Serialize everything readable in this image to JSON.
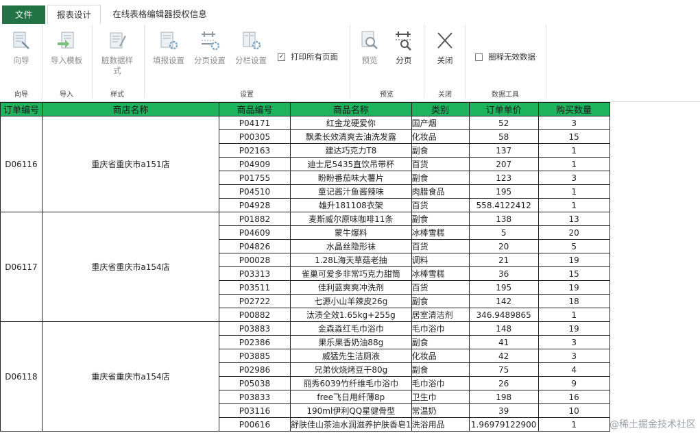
{
  "tabs": {
    "file": "文件",
    "report_design": "报表设计",
    "license_info": "在线表格编辑器授权信息"
  },
  "ribbon": {
    "wizard": "向导",
    "import_template": "导入模板",
    "dirty_style": "脏数据样式",
    "fill_settings": "填报设置",
    "page_settings": "分页设置",
    "column_settings": "分栏设置",
    "print_all": "打印所有页面",
    "preview": "预览",
    "paging": "分页",
    "close": "关闭",
    "circle_invalid": "圈释无效数据",
    "groups": {
      "wizard": "向导",
      "import": "导入",
      "style": "样式",
      "settings": "设置",
      "preview": "预览",
      "close": "关闭",
      "data_tools": "数据工具"
    }
  },
  "table": {
    "headers": [
      "订单编号",
      "商店名称",
      "商品编号",
      "商品名称",
      "类别",
      "订单单价",
      "购买数量"
    ],
    "groups": [
      {
        "order": "D06116",
        "store": "重庆省重庆市a151店",
        "rows": [
          [
            "P04171",
            "红金龙硬爱你",
            "国产烟",
            "52",
            "3"
          ],
          [
            "P00305",
            "飘柔长效清爽去油洗发露",
            "化妆品",
            "58",
            "15"
          ],
          [
            "P02163",
            "建达巧克力T8",
            "副食",
            "137",
            "1"
          ],
          [
            "P04909",
            "迪士尼5435直饮吊带杯",
            "百货",
            "207",
            "1"
          ],
          [
            "P01755",
            "盼盼番茄味大薯片",
            "副食",
            "123",
            "3"
          ],
          [
            "P04510",
            "童记酱汁鱼酱辣味",
            "肉腊食品",
            "195",
            "1"
          ],
          [
            "P04928",
            "雄升181108衣架",
            "百货",
            "558.4122412",
            "1"
          ]
        ]
      },
      {
        "order": "D06117",
        "store": "重庆省重庆市a154店",
        "rows": [
          [
            "P01882",
            "麦斯威尔原味咖啡11条",
            "副食",
            "138",
            "13"
          ],
          [
            "P04609",
            "蒙牛爆料",
            "冰棒雪糕",
            "5",
            "20"
          ],
          [
            "P04826",
            "水晶丝隐形袜",
            "百货",
            "20",
            "5"
          ],
          [
            "P00028",
            "1.28L海天草菇老抽",
            "调料",
            "21",
            "19"
          ],
          [
            "P03313",
            "雀巢可爱多非常巧克力甜筒",
            "冰棒雪糕",
            "36",
            "15"
          ],
          [
            "P03511",
            "佳利蓝爽爽冲洗剂",
            "百货",
            "195",
            "19"
          ],
          [
            "P02722",
            "七源小山羊辣皮26g",
            "副食",
            "142",
            "18"
          ],
          [
            "P00882",
            "汰渍全效1.65kg+255g",
            "居室清洁剂",
            "346.9489865",
            "1"
          ]
        ]
      },
      {
        "order": "D06118",
        "store": "重庆省重庆市a154店",
        "rows": [
          [
            "P03883",
            "金森淼红毛巾浴巾",
            "毛巾浴巾",
            "148",
            "19"
          ],
          [
            "P02386",
            "果乐果香奶油88g",
            "副食",
            "41",
            "3"
          ],
          [
            "P03885",
            "威猛先生洁厕液",
            "化妆品",
            "42",
            "3"
          ],
          [
            "P02986",
            "兄弟伙烧烤豆干80g",
            "副食",
            "75",
            "4"
          ],
          [
            "P05038",
            "丽秀6039竹纤维毛巾浴巾",
            "毛巾浴巾",
            "26",
            "9"
          ],
          [
            "P03833",
            "free飞日用纤薄8p",
            "卫生巾",
            "198",
            "16"
          ],
          [
            "P03116",
            "190ml伊利QQ星健骨型",
            "常温奶",
            "39",
            "10"
          ],
          [
            "P00616",
            "舒肤佳山茶油水润滋养护肤香皂1",
            "洗浴用品",
            "1.96979122900",
            "1"
          ]
        ]
      }
    ]
  },
  "watermark": "@稀土掘金技术社区"
}
